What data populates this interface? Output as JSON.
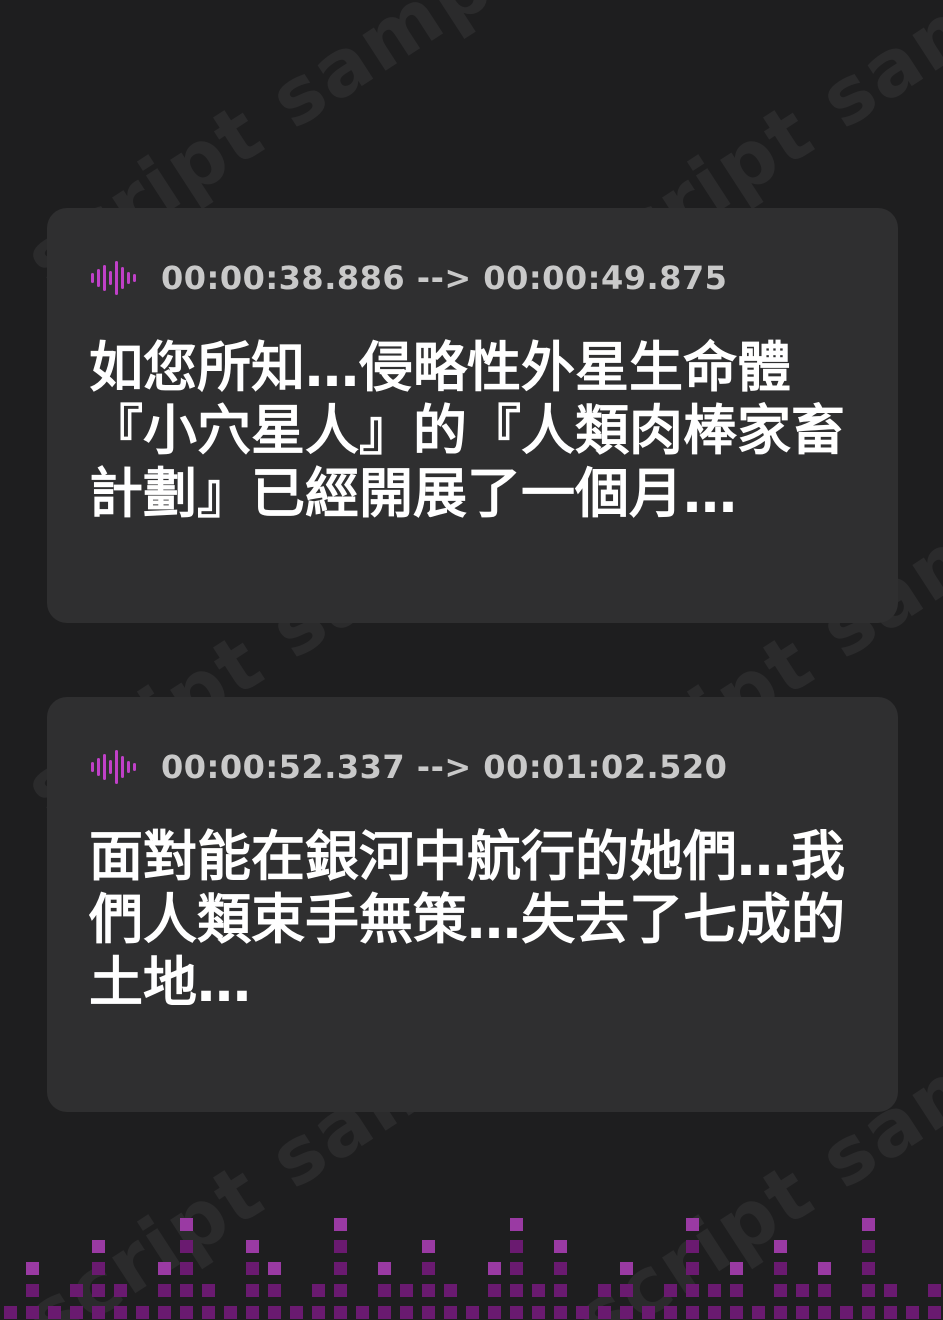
{
  "watermark": {
    "text": "script sample"
  },
  "cards": [
    {
      "timestamp": "00:00:38.886 --> 00:00:49.875",
      "text": "如您所知…侵略性外星生命體『小穴星人』的『人類肉棒家畜計劃』已經開展了一個月…"
    },
    {
      "timestamp": "00:00:52.337 --> 00:01:02.520",
      "text": "面對能在銀河中航行的她們…我們人類束手無策…失去了七成的土地…"
    }
  ],
  "icons": {
    "audio": "audio-wave-icon"
  },
  "colors": {
    "background": "#1e1e1f",
    "card": "#2f2f30",
    "timestamp": "#c9c9c9",
    "accent": "#c040c8",
    "eq_dark": "#6a1a70",
    "eq_light": "#9a3aa3"
  }
}
